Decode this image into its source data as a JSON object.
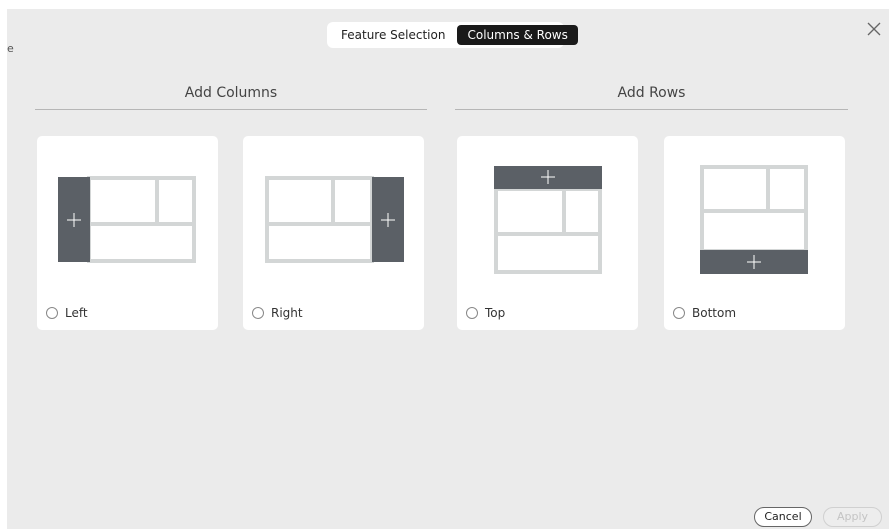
{
  "dialog": {
    "side_mark": "e",
    "tabs": [
      {
        "label": "Feature Selection",
        "active": false
      },
      {
        "label": "Columns & Rows",
        "active": true
      }
    ],
    "close_icon": "close-icon"
  },
  "sections": {
    "columns_title": "Add Columns",
    "rows_title": "Add Rows"
  },
  "options": [
    {
      "label": "Left",
      "selected": false
    },
    {
      "label": "Right",
      "selected": false
    },
    {
      "label": "Top",
      "selected": false
    },
    {
      "label": "Bottom",
      "selected": false
    }
  ],
  "footer": {
    "cancel_label": "Cancel",
    "apply_label": "Apply",
    "apply_enabled": false
  },
  "colors": {
    "background": "#ebebeb",
    "card": "#ffffff",
    "layout_outline": "#d3d6d6",
    "added_region": "#5b6066",
    "active_tab": "#1a1a1a"
  }
}
